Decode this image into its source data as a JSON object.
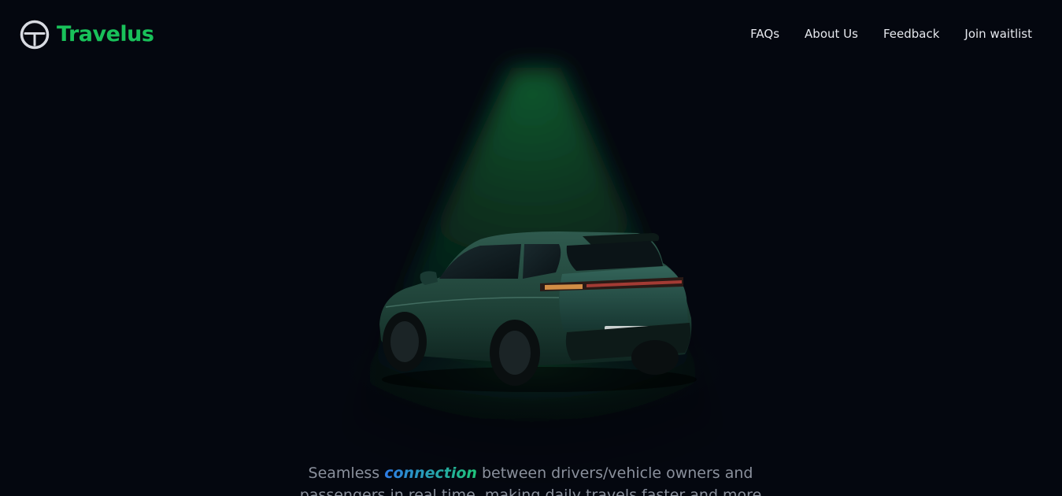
{
  "brand": {
    "name": "Travelus",
    "icon": "steering-wheel-icon",
    "color": "#19c15a"
  },
  "nav": {
    "items": [
      {
        "label": "FAQs"
      },
      {
        "label": "About Us"
      },
      {
        "label": "Feedback"
      },
      {
        "label": "Join waitlist"
      }
    ]
  },
  "hero": {
    "image": "green-suv-rear-view",
    "spotlight_color": "#0f5a2e",
    "tagline": {
      "before": "Seamless",
      "highlight": "connection",
      "after": "between drivers/vehicle owners and passengers in real time, making daily travels faster and more"
    }
  },
  "colors": {
    "background": "#04070f",
    "nav_text": "#e6e8ee",
    "tagline_text": "#8a909c",
    "highlight_gradient_start": "#2f7de8",
    "highlight_gradient_end": "#1fc47a"
  }
}
